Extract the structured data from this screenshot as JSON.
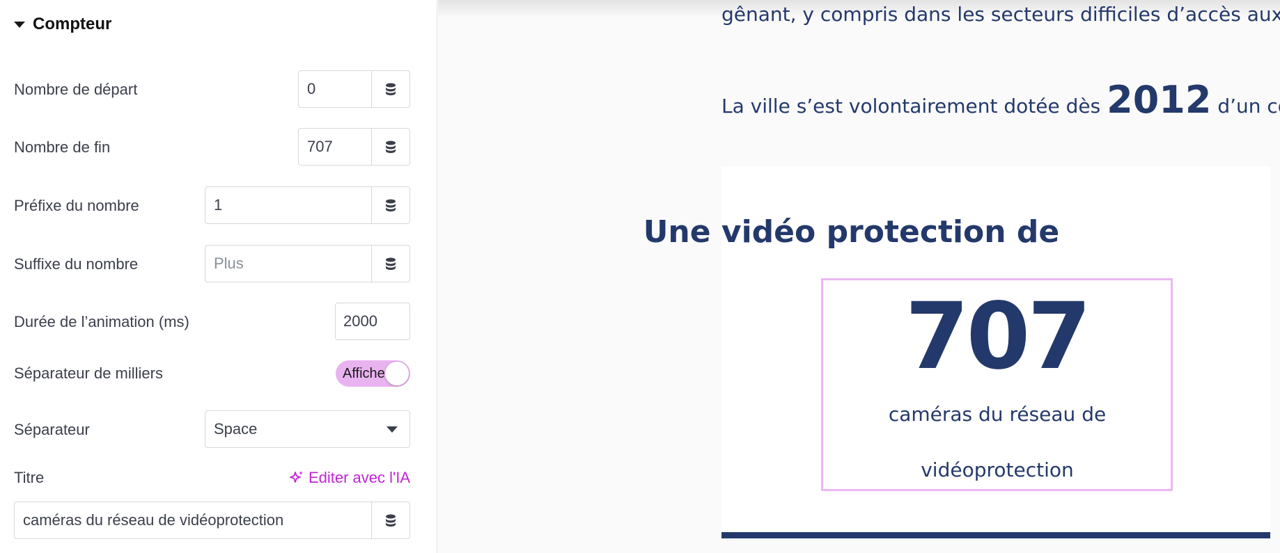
{
  "panel": {
    "section_title": "Compteur",
    "fields": {
      "start_number": {
        "label": "Nombre de départ",
        "value": "0"
      },
      "end_number": {
        "label": "Nombre de fin",
        "value": "707"
      },
      "prefix": {
        "label": "Préfixe du nombre",
        "value": "1"
      },
      "suffix": {
        "label": "Suffixe du nombre",
        "placeholder": "Plus"
      },
      "duration": {
        "label": "Durée de l’animation (ms)",
        "value": "2000"
      },
      "thousands_separator": {
        "label": "Séparateur de milliers",
        "toggle_text": "Affiche",
        "on": true
      },
      "separator": {
        "label": "Séparateur",
        "value": "Space"
      },
      "title": {
        "label": "Titre",
        "ai_link": "Editer avec l'IA",
        "value": "caméras du réseau de vidéoprotection"
      }
    }
  },
  "preview": {
    "line1": "gênant, y compris dans les secteurs difficiles d’accès aux p",
    "line2_before": "La ville s’est volontairement dotée dès ",
    "line2_year": "2012",
    "line2_after": " d’un comit",
    "card_title": "Une vidéo protection de",
    "counter_value": "707",
    "counter_title": "caméras du réseau de vidéoprotection"
  },
  "colors": {
    "navy": "#24396b",
    "accent_pink": "#c125d6",
    "toggle_bg": "#e9b3f0",
    "counter_border": "#ebb7f2"
  }
}
